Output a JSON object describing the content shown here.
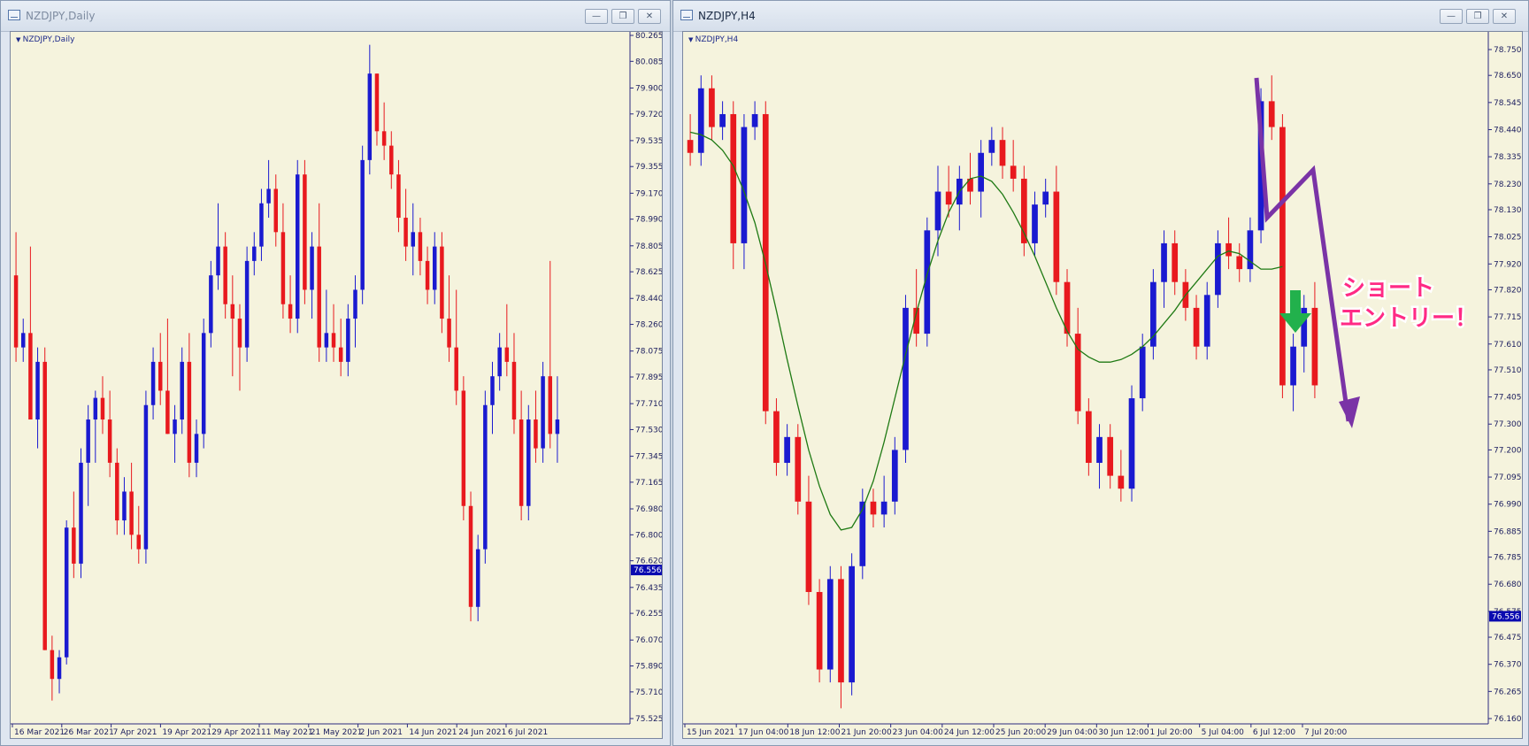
{
  "windows": [
    {
      "title": "NZDJPY,Daily",
      "chart_label": "NZDJPY,Daily",
      "buttons": {
        "minimize": "—",
        "maximize": "❐",
        "close": "✕"
      },
      "current_price": "76.556",
      "price_ticks": [
        "80.265",
        "80.085",
        "79.900",
        "79.720",
        "79.535",
        "79.355",
        "79.170",
        "78.990",
        "78.805",
        "78.625",
        "78.440",
        "78.260",
        "78.075",
        "77.895",
        "77.710",
        "77.530",
        "77.345",
        "77.165",
        "76.980",
        "76.800",
        "76.620",
        "76.435",
        "76.255",
        "76.070",
        "75.890",
        "75.710",
        "75.525"
      ],
      "time_ticks": [
        "16 Mar 2021",
        "26 Mar 2021",
        "7 Apr 2021",
        "19 Apr 2021",
        "29 Apr 2021",
        "11 May 2021",
        "21 May 2021",
        "2 Jun 2021",
        "14 Jun 2021",
        "24 Jun 2021",
        "6 Jul 2021"
      ]
    },
    {
      "title": "NZDJPY,H4",
      "chart_label": "NZDJPY,H4",
      "buttons": {
        "minimize": "—",
        "maximize": "❐",
        "close": "✕"
      },
      "current_price": "76.556",
      "price_ticks": [
        "78.750",
        "78.650",
        "78.545",
        "78.440",
        "78.335",
        "78.230",
        "78.130",
        "78.025",
        "77.920",
        "77.820",
        "77.715",
        "77.610",
        "77.510",
        "77.405",
        "77.300",
        "77.200",
        "77.095",
        "76.990",
        "76.885",
        "76.785",
        "76.680",
        "76.575",
        "76.475",
        "76.370",
        "76.265",
        "76.160"
      ],
      "time_ticks": [
        "15 Jun 2021",
        "17 Jun 04:00",
        "18 Jun 12:00",
        "21 Jun 20:00",
        "23 Jun 04:00",
        "24 Jun 12:00",
        "25 Jun 20:00",
        "29 Jun 04:00",
        "30 Jun 12:00",
        "1 Jul 20:00",
        "5 Jul 04:00",
        "6 Jul 12:00",
        "7 Jul 20:00"
      ],
      "annotation": {
        "line1": "ショート",
        "line2": "エントリー！"
      }
    }
  ],
  "colors": {
    "bull": "#1a1ad0",
    "bear": "#e8191e",
    "ma": "#1f7a14",
    "trend": "#7a33a6",
    "entry_arrow": "#22b14c",
    "chart_bg": "#f5f3dd",
    "price_tag": "#0a0ab0"
  },
  "chart_data": [
    {
      "type": "candlestick",
      "title": "NZDJPY,Daily",
      "ylim": [
        75.525,
        80.265
      ],
      "series": [
        {
          "name": "NZDJPY",
          "ohlc": [
            [
              78.6,
              78.9,
              78.0,
              78.1
            ],
            [
              78.1,
              78.3,
              78.0,
              78.2
            ],
            [
              78.2,
              78.8,
              77.6,
              77.6
            ],
            [
              77.6,
              78.1,
              77.4,
              78.0
            ],
            [
              78.0,
              78.1,
              76.0,
              76.0
            ],
            [
              76.0,
              76.1,
              75.65,
              75.8
            ],
            [
              75.8,
              76.0,
              75.7,
              75.95
            ],
            [
              75.95,
              76.9,
              75.9,
              76.85
            ],
            [
              76.85,
              77.1,
              76.5,
              76.6
            ],
            [
              76.6,
              77.4,
              76.5,
              77.3
            ],
            [
              77.3,
              77.7,
              77.0,
              77.6
            ],
            [
              77.6,
              77.8,
              77.3,
              77.75
            ],
            [
              77.75,
              77.9,
              77.5,
              77.6
            ],
            [
              77.6,
              77.8,
              77.2,
              77.3
            ],
            [
              77.3,
              77.4,
              76.8,
              76.9
            ],
            [
              76.9,
              77.2,
              76.8,
              77.1
            ],
            [
              77.1,
              77.3,
              76.7,
              76.8
            ],
            [
              76.8,
              77.0,
              76.6,
              76.7
            ],
            [
              76.7,
              77.8,
              76.6,
              77.7
            ],
            [
              77.7,
              78.1,
              77.6,
              78.0
            ],
            [
              78.0,
              78.2,
              77.7,
              77.8
            ],
            [
              77.8,
              78.3,
              77.5,
              77.5
            ],
            [
              77.5,
              77.7,
              77.3,
              77.6
            ],
            [
              77.6,
              78.1,
              77.5,
              78.0
            ],
            [
              78.0,
              78.2,
              77.2,
              77.3
            ],
            [
              77.3,
              77.6,
              77.2,
              77.5
            ],
            [
              77.5,
              78.3,
              77.4,
              78.2
            ],
            [
              78.2,
              78.7,
              78.1,
              78.6
            ],
            [
              78.6,
              79.1,
              78.5,
              78.8
            ],
            [
              78.8,
              78.9,
              78.3,
              78.4
            ],
            [
              78.4,
              78.6,
              77.9,
              78.3
            ],
            [
              78.3,
              78.4,
              77.8,
              78.1
            ],
            [
              78.1,
              78.8,
              78.0,
              78.7
            ],
            [
              78.7,
              78.9,
              78.6,
              78.8
            ],
            [
              78.8,
              79.2,
              78.7,
              79.1
            ],
            [
              79.1,
              79.4,
              79.0,
              79.2
            ],
            [
              79.2,
              79.3,
              78.8,
              78.9
            ],
            [
              78.9,
              79.1,
              78.3,
              78.4
            ],
            [
              78.4,
              78.6,
              78.2,
              78.3
            ],
            [
              78.3,
              79.4,
              78.2,
              79.3
            ],
            [
              79.3,
              79.4,
              78.4,
              78.5
            ],
            [
              78.5,
              78.9,
              78.3,
              78.8
            ],
            [
              78.8,
              79.1,
              78.0,
              78.1
            ],
            [
              78.1,
              78.5,
              78.0,
              78.2
            ],
            [
              78.2,
              78.4,
              78.0,
              78.1
            ],
            [
              78.1,
              78.3,
              77.9,
              78.0
            ],
            [
              78.0,
              78.4,
              77.9,
              78.3
            ],
            [
              78.3,
              78.6,
              78.1,
              78.5
            ],
            [
              78.5,
              79.5,
              78.4,
              79.4
            ],
            [
              79.4,
              80.2,
              79.3,
              80.0
            ],
            [
              80.0,
              80.0,
              79.5,
              79.6
            ],
            [
              79.6,
              79.8,
              79.4,
              79.5
            ],
            [
              79.5,
              79.6,
              79.2,
              79.3
            ],
            [
              79.3,
              79.4,
              78.9,
              79.0
            ],
            [
              79.0,
              79.2,
              78.7,
              78.8
            ],
            [
              78.8,
              79.1,
              78.6,
              78.9
            ],
            [
              78.9,
              79.0,
              78.6,
              78.7
            ],
            [
              78.7,
              78.8,
              78.4,
              78.5
            ],
            [
              78.5,
              78.9,
              78.4,
              78.8
            ],
            [
              78.8,
              78.9,
              78.2,
              78.3
            ],
            [
              78.3,
              78.6,
              78.0,
              78.1
            ],
            [
              78.1,
              78.5,
              77.7,
              77.8
            ],
            [
              77.8,
              77.9,
              76.9,
              77.0
            ],
            [
              77.0,
              77.1,
              76.2,
              76.3
            ],
            [
              76.3,
              76.8,
              76.2,
              76.7
            ],
            [
              76.7,
              77.8,
              76.6,
              77.7
            ],
            [
              77.7,
              78.0,
              77.5,
              77.9
            ],
            [
              77.9,
              78.2,
              77.8,
              78.1
            ],
            [
              78.1,
              78.4,
              77.9,
              78.0
            ],
            [
              78.0,
              78.2,
              77.5,
              77.6
            ],
            [
              77.6,
              77.8,
              76.9,
              77.0
            ],
            [
              77.0,
              77.7,
              76.9,
              77.6
            ],
            [
              77.6,
              77.8,
              77.3,
              77.4
            ],
            [
              77.4,
              78.0,
              77.3,
              77.9
            ],
            [
              77.9,
              78.7,
              77.4,
              77.5
            ],
            [
              77.5,
              77.9,
              77.3,
              77.6
            ]
          ]
        }
      ]
    },
    {
      "type": "candlestick",
      "title": "NZDJPY,H4",
      "ylim": [
        76.16,
        78.75
      ],
      "series": [
        {
          "name": "NZDJPY",
          "ohlc": [
            [
              78.4,
              78.5,
              78.3,
              78.35
            ],
            [
              78.35,
              78.65,
              78.3,
              78.6
            ],
            [
              78.6,
              78.65,
              78.4,
              78.45
            ],
            [
              78.45,
              78.55,
              78.4,
              78.5
            ],
            [
              78.5,
              78.55,
              77.9,
              78.0
            ],
            [
              78.0,
              78.5,
              77.9,
              78.45
            ],
            [
              78.45,
              78.55,
              78.4,
              78.5
            ],
            [
              78.5,
              78.55,
              77.3,
              77.35
            ],
            [
              77.35,
              77.4,
              77.1,
              77.15
            ],
            [
              77.15,
              77.3,
              77.1,
              77.25
            ],
            [
              77.25,
              77.3,
              76.95,
              77.0
            ],
            [
              77.0,
              77.1,
              76.6,
              76.65
            ],
            [
              76.65,
              76.7,
              76.3,
              76.35
            ],
            [
              76.35,
              76.75,
              76.3,
              76.7
            ],
            [
              76.7,
              76.75,
              76.2,
              76.3
            ],
            [
              76.3,
              76.8,
              76.25,
              76.75
            ],
            [
              76.75,
              77.05,
              76.7,
              77.0
            ],
            [
              77.0,
              77.05,
              76.9,
              76.95
            ],
            [
              76.95,
              77.1,
              76.9,
              77.0
            ],
            [
              77.0,
              77.25,
              76.95,
              77.2
            ],
            [
              77.2,
              77.8,
              77.15,
              77.75
            ],
            [
              77.75,
              77.9,
              77.6,
              77.65
            ],
            [
              77.65,
              78.1,
              77.6,
              78.05
            ],
            [
              78.05,
              78.3,
              77.95,
              78.2
            ],
            [
              78.2,
              78.3,
              78.1,
              78.15
            ],
            [
              78.15,
              78.3,
              78.05,
              78.25
            ],
            [
              78.25,
              78.35,
              78.15,
              78.2
            ],
            [
              78.2,
              78.4,
              78.1,
              78.35
            ],
            [
              78.35,
              78.45,
              78.3,
              78.4
            ],
            [
              78.4,
              78.45,
              78.25,
              78.3
            ],
            [
              78.3,
              78.4,
              78.2,
              78.25
            ],
            [
              78.25,
              78.3,
              77.95,
              78.0
            ],
            [
              78.0,
              78.2,
              77.95,
              78.15
            ],
            [
              78.15,
              78.25,
              78.1,
              78.2
            ],
            [
              78.2,
              78.3,
              77.8,
              77.85
            ],
            [
              77.85,
              77.9,
              77.6,
              77.65
            ],
            [
              77.65,
              77.75,
              77.3,
              77.35
            ],
            [
              77.35,
              77.4,
              77.1,
              77.15
            ],
            [
              77.15,
              77.3,
              77.05,
              77.25
            ],
            [
              77.25,
              77.3,
              77.05,
              77.1
            ],
            [
              77.1,
              77.2,
              77.0,
              77.05
            ],
            [
              77.05,
              77.45,
              77.0,
              77.4
            ],
            [
              77.4,
              77.65,
              77.35,
              77.6
            ],
            [
              77.6,
              77.9,
              77.55,
              77.85
            ],
            [
              77.85,
              78.05,
              77.75,
              78.0
            ],
            [
              78.0,
              78.05,
              77.8,
              77.85
            ],
            [
              77.85,
              77.9,
              77.7,
              77.75
            ],
            [
              77.75,
              77.8,
              77.55,
              77.6
            ],
            [
              77.6,
              77.85,
              77.55,
              77.8
            ],
            [
              77.8,
              78.05,
              77.75,
              78.0
            ],
            [
              78.0,
              78.1,
              77.9,
              77.95
            ],
            [
              77.95,
              78.0,
              77.85,
              77.9
            ],
            [
              77.9,
              78.1,
              77.85,
              78.05
            ],
            [
              78.05,
              78.6,
              78.0,
              78.55
            ],
            [
              78.55,
              78.65,
              78.4,
              78.45
            ],
            [
              78.45,
              78.5,
              77.4,
              77.45
            ],
            [
              77.45,
              77.65,
              77.35,
              77.6
            ],
            [
              77.6,
              77.8,
              77.5,
              77.75
            ],
            [
              77.75,
              77.85,
              77.4,
              77.45
            ]
          ]
        },
        {
          "name": "MA",
          "values": [
            78.43,
            78.42,
            78.4,
            78.36,
            78.3,
            78.2,
            78.08,
            77.92,
            77.74,
            77.55,
            77.37,
            77.2,
            77.06,
            76.95,
            76.89,
            76.9,
            76.97,
            77.08,
            77.23,
            77.4,
            77.57,
            77.73,
            77.88,
            78.01,
            78.12,
            78.2,
            78.25,
            78.26,
            78.24,
            78.19,
            78.12,
            78.04,
            77.95,
            77.85,
            77.75,
            77.66,
            77.59,
            77.56,
            77.54,
            77.54,
            77.55,
            77.57,
            77.6,
            77.64,
            77.69,
            77.74,
            77.8,
            77.85,
            77.9,
            77.95,
            77.97,
            77.96,
            77.93,
            77.9,
            77.9,
            77.91
          ]
        }
      ]
    }
  ]
}
